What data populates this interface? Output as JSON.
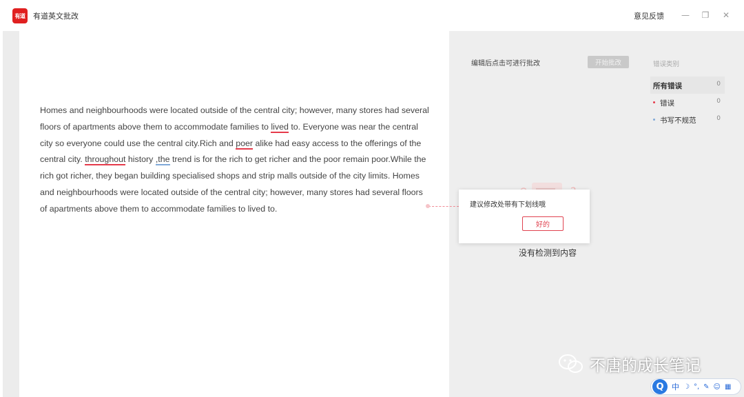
{
  "titlebar": {
    "logo_text": "有道",
    "app_title": "有道英文批改",
    "feedback": "意见反馈",
    "minimize_glyph": "—",
    "maximize_glyph": "❐",
    "close_glyph": "✕"
  },
  "editor": {
    "segments": [
      {
        "text": "Homes and neighbourhoods were located outside of the central city; however, many stores had several floors of apartments above them to accommodate families to ",
        "mark": "none"
      },
      {
        "text": "lived",
        "mark": "red"
      },
      {
        "text": " to. Everyone was near the central city so everyone could use the central city.Rich and ",
        "mark": "none"
      },
      {
        "text": "poer",
        "mark": "red"
      },
      {
        "text": " alike had easy access to the offerings of the central city. ",
        "mark": "none"
      },
      {
        "text": "throughout",
        "mark": "red"
      },
      {
        "text": " history ",
        "mark": "none"
      },
      {
        "text": ",the",
        "mark": "blue"
      },
      {
        "text": " trend is for the rich to get richer and the poor remain poor.While the rich got richer, they began building specialised shops and strip malls outside of the city limits. Homes and neighbourhoods were located outside of the central city; however, many stores had several floors of apartments above them to accommodate families to lived to.",
        "mark": "none"
      }
    ]
  },
  "panel": {
    "hint": "编辑后点击可进行批改",
    "start_button": "开始批改",
    "category_title": "错误类别",
    "categories": [
      {
        "label": "所有错误",
        "count": "0",
        "dot_color": ""
      },
      {
        "label": "错误",
        "count": "0",
        "dot_color": "#e53a4a"
      },
      {
        "label": "书写不规范",
        "count": "0",
        "dot_color": "#7fa8d8"
      }
    ],
    "empty_text": "没有检测到内容"
  },
  "tooltip": {
    "text": "建议修改处带有下划线哦",
    "ok_button": "好的"
  },
  "watermark": {
    "text": "不唐的成长笔记"
  },
  "ime": {
    "logo": "Q",
    "lang": "中",
    "icons": [
      "☽",
      "°,",
      "✎",
      "☺",
      "▦"
    ]
  },
  "colors": {
    "brand_red": "#e02020",
    "error_red": "#e53a4a",
    "style_blue": "#7fa8d8"
  }
}
